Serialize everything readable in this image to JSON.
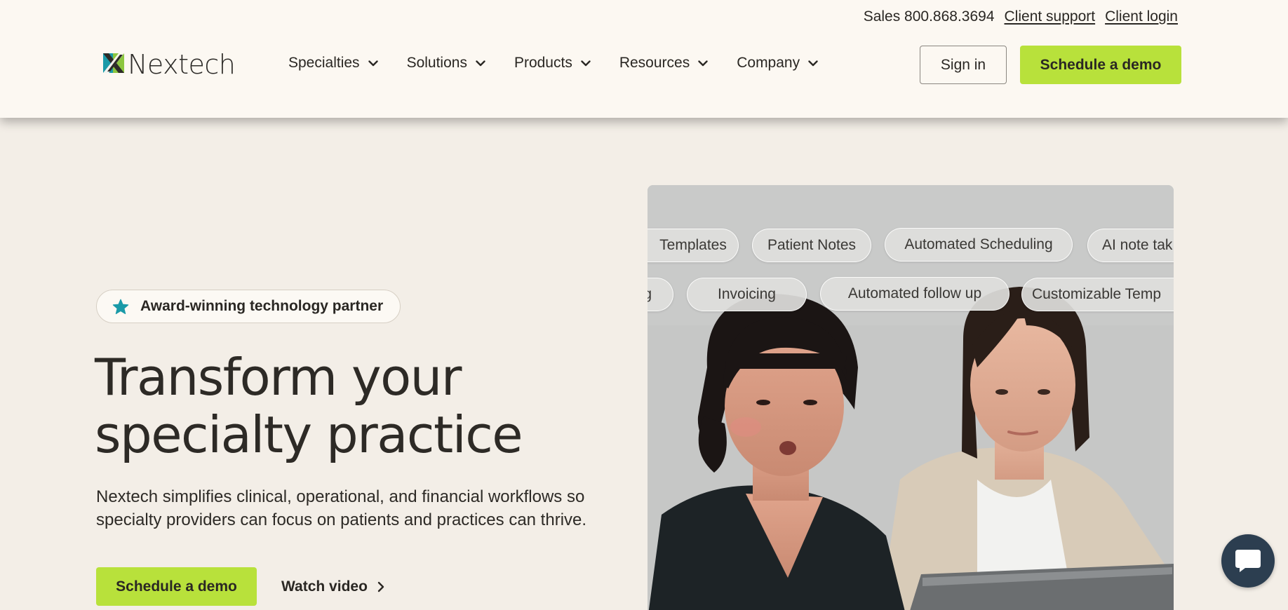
{
  "utility": {
    "sales": "Sales 800.868.3694",
    "client_support": "Client support",
    "client_login": "Client login"
  },
  "logo": {
    "text": "Nextech",
    "icon": "nextech-logo-icon"
  },
  "nav": [
    {
      "label": "Specialties",
      "icon": "chevron-down-icon"
    },
    {
      "label": "Solutions",
      "icon": "chevron-down-icon"
    },
    {
      "label": "Products",
      "icon": "chevron-down-icon"
    },
    {
      "label": "Resources",
      "icon": "chevron-down-icon"
    },
    {
      "label": "Company",
      "icon": "chevron-down-icon"
    }
  ],
  "header_buttons": {
    "sign_in": "Sign in",
    "schedule_demo": "Schedule a demo"
  },
  "hero": {
    "badge": "Award-winning technology partner",
    "badge_icon": "star-icon",
    "headline_line1": "Transform your",
    "headline_line2": "specialty practice",
    "subtext": "Nextech simplifies clinical, operational, and financial workflows so specialty providers can focus on patients and practices can thrive.",
    "cta_primary": "Schedule a demo",
    "cta_secondary": "Watch video",
    "cta_secondary_icon": "chevron-right-icon"
  },
  "chips_row1": [
    "Templates",
    "Patient Notes",
    "Automated Scheduling",
    "AI note tak"
  ],
  "chips_row2": [
    "g",
    "Invoicing",
    "Automated follow up",
    "Customizable Temp"
  ],
  "colors": {
    "accent_green": "#b8e13b",
    "header_bg": "#fcf8f2",
    "page_bg": "#f3eee7",
    "star_teal": "#1a9aa8",
    "chat_bg": "#2c3e50"
  }
}
